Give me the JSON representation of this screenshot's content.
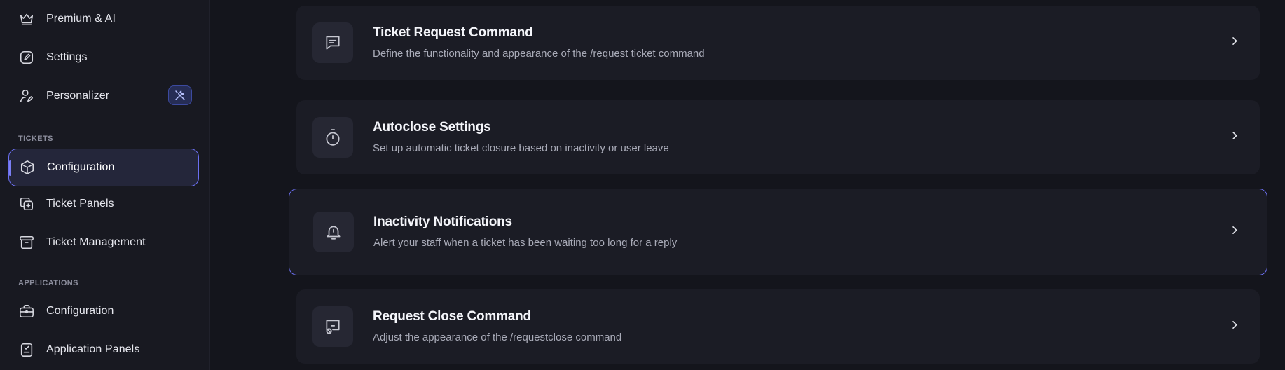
{
  "sidebar": {
    "items_top": [
      {
        "label": "Premium & AI",
        "icon": "crown-icon"
      },
      {
        "label": "Settings",
        "icon": "pencil-square-icon"
      },
      {
        "label": "Personalizer",
        "icon": "user-edit-icon",
        "badge_icon": "tools-icon"
      }
    ],
    "tickets_section": "TICKETS",
    "tickets_items": [
      {
        "label": "Configuration",
        "icon": "cube-icon",
        "active": true
      },
      {
        "label": "Ticket Panels",
        "icon": "copy-plus-icon"
      },
      {
        "label": "Ticket Management",
        "icon": "archive-icon"
      }
    ],
    "applications_section": "APPLICATIONS",
    "applications_items": [
      {
        "label": "Configuration",
        "icon": "briefcase-icon"
      },
      {
        "label": "Application Panels",
        "icon": "clipboard-icon"
      }
    ]
  },
  "cards": [
    {
      "title": "Ticket Request Command",
      "desc": "Define the functionality and appearance of the /request ticket command",
      "icon": "message-square-icon"
    },
    {
      "title": "Autoclose Settings",
      "desc": "Set up automatic ticket closure based on inactivity or user leave",
      "icon": "timer-icon"
    },
    {
      "title": "Inactivity Notifications",
      "desc": "Alert your staff when a ticket has been waiting too long for a reply",
      "icon": "bell-icon"
    },
    {
      "title": "Request Close Command",
      "desc": "Adjust the appearance of the /requestclose command",
      "icon": "message-close-icon"
    }
  ],
  "colors": {
    "accent": "#6b6ff0",
    "background": "#14151c",
    "sidebar": "#181921",
    "card": "#1b1c25"
  }
}
